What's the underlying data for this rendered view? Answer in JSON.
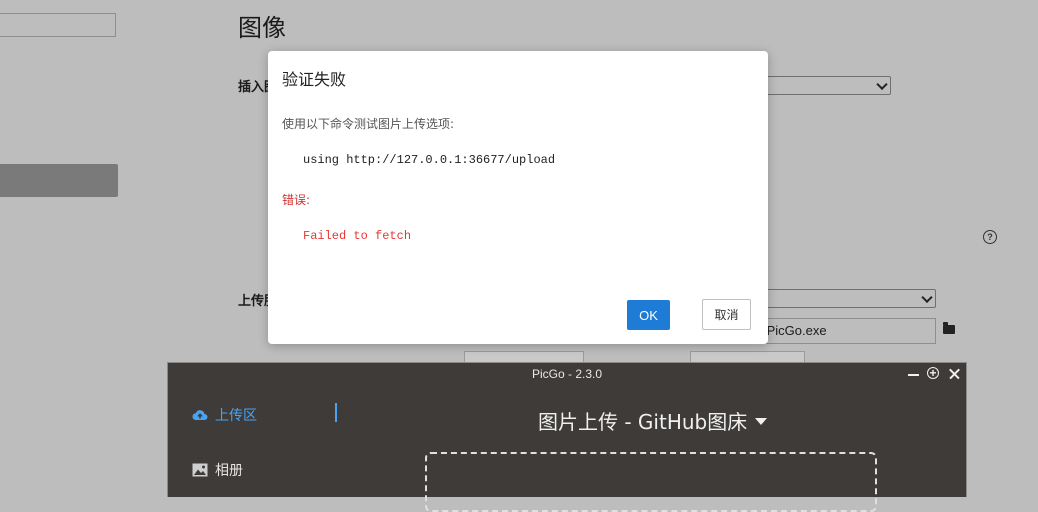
{
  "settings_page": {
    "heading": "图像",
    "insert_label": "插入图",
    "upload_label": "上传服",
    "path_value": "\\PicGo.exe"
  },
  "dialog": {
    "title": "验证失败",
    "description": "使用以下命令测试图片上传选项:",
    "command": "using http://127.0.0.1:36677/upload",
    "error_label": "错误:",
    "error_message": "Failed to fetch",
    "ok_label": "OK",
    "cancel_label": "取消",
    "ok_color": "#1e7bd6",
    "error_color": "#e53935"
  },
  "picgo": {
    "window_title": "PicGo - 2.3.0",
    "nav": [
      {
        "label": "上传区",
        "icon": "cloud-upload-icon",
        "active": true
      },
      {
        "label": "相册",
        "icon": "image-icon",
        "active": false
      }
    ],
    "heading": "图片上传 - GitHub图床",
    "accent_color": "#4aa3f0"
  }
}
